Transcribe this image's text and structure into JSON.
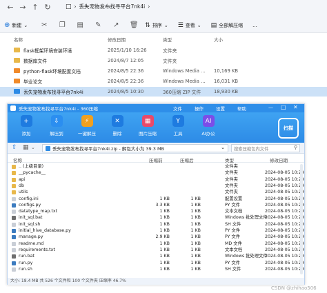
{
  "explorer": {
    "path": [
      "丢失宠物发布找寻平台7nk4i"
    ],
    "toolbar": {
      "new": "新建",
      "sort": "排序",
      "view": "查看",
      "extract_all": "全部解压缩",
      "more": "..."
    },
    "headers": {
      "name": "名称",
      "modified": "修改日期",
      "type": "类型",
      "size": "大小"
    },
    "rows": [
      {
        "name": "flask框架环境安装环境",
        "modified": "2025/1/10 16:26",
        "type": "文件夹",
        "size": "",
        "icon": "folder"
      },
      {
        "name": "数据库文件",
        "modified": "2024/8/7 12:05",
        "type": "文件夹",
        "size": "",
        "icon": "folder"
      },
      {
        "name": "python-flask环境配置文档",
        "modified": "2024/8/5 22:36",
        "type": "Windows Media ...",
        "size": "10,169 KB",
        "icon": "media"
      },
      {
        "name": "毕业论文",
        "modified": "2024/8/5 22:36",
        "type": "Windows Media ...",
        "size": "16,031 KB",
        "icon": "media"
      },
      {
        "name": "丢失宠物发布找寻平台7nk4i",
        "modified": "2024/8/5 10:30",
        "type": "360压缩 ZIP 文件",
        "size": "18,930 KB",
        "icon": "zip",
        "selected": true
      }
    ]
  },
  "zip": {
    "title": "丢失宠物发布找寻平台7nk4i - 360压缩",
    "menu": [
      "文件",
      "操作",
      "设置",
      "帮助"
    ],
    "ribbon": [
      {
        "label": "添加",
        "icon": "add-icon",
        "color": "#1e7be0"
      },
      {
        "label": "解压到",
        "icon": "extract-icon",
        "color": "#2b8ef0"
      },
      {
        "label": "一键解压",
        "icon": "one-click-icon",
        "color": "#f0a020"
      },
      {
        "label": "删除",
        "icon": "delete-icon",
        "color": "#1e7be0"
      },
      {
        "label": "图片压缩",
        "icon": "image-compress-icon",
        "color": "#e84a6a"
      },
      {
        "label": "工具",
        "icon": "tools-icon",
        "color": "#1e7be0"
      },
      {
        "label": "AI办公",
        "icon": "ai-icon",
        "color": "#7b4de8"
      }
    ],
    "scan_label": "扫描",
    "path": "丢失宠物发布找寻平台7nk4i.zip - 解包大小为 39.3 MB",
    "search_placeholder": "搜索压缩包内文件",
    "headers": {
      "name": "名称",
      "compressed": "压缩前",
      "size": "压缩后",
      "type": "类型",
      "modified": "修改日期"
    },
    "rows": [
      {
        "name": ".. (上级目录)",
        "compressed": "",
        "size": "",
        "type": "文件夹",
        "modified": "",
        "icon": "folder"
      },
      {
        "name": "__pycache__",
        "compressed": "",
        "size": "",
        "type": "文件夹",
        "modified": "2024-08-05 10:29",
        "icon": "folder"
      },
      {
        "name": "api",
        "compressed": "",
        "size": "",
        "type": "文件夹",
        "modified": "2024-08-05 10:29",
        "icon": "folder"
      },
      {
        "name": "db",
        "compressed": "",
        "size": "",
        "type": "文件夹",
        "modified": "2024-08-05 10:29",
        "icon": "folder"
      },
      {
        "name": "utils",
        "compressed": "",
        "size": "",
        "type": "文件夹",
        "modified": "2024-08-05 10:29",
        "icon": "folder"
      },
      {
        "name": "config.ini",
        "compressed": "1 KB",
        "size": "1 KB",
        "type": "配置设置",
        "modified": "2024-08-05 10:29",
        "icon": "file"
      },
      {
        "name": "configs.py",
        "compressed": "3.3 KB",
        "size": "1 KB",
        "type": "PY 文件",
        "modified": "2024-08-05 10:29",
        "icon": "py"
      },
      {
        "name": "datatype_map.txt",
        "compressed": "1 KB",
        "size": "1 KB",
        "type": "文本文档",
        "modified": "2024-08-05 10:29",
        "icon": "file"
      },
      {
        "name": "init_sql.bat",
        "compressed": "1 KB",
        "size": "1 KB",
        "type": "Windows 批处理文件",
        "modified": "2024-08-05 10:29",
        "icon": "bat"
      },
      {
        "name": "init_sql.sh",
        "compressed": "1 KB",
        "size": "1 KB",
        "type": "SH 文件",
        "modified": "2024-08-05 10:29",
        "icon": "file"
      },
      {
        "name": "initial_hive_database.py",
        "compressed": "1 KB",
        "size": "1 KB",
        "type": "PY 文件",
        "modified": "2024-08-05 10:29",
        "icon": "py"
      },
      {
        "name": "manage.py",
        "compressed": "2.9 KB",
        "size": "1 KB",
        "type": "PY 文件",
        "modified": "2024-08-05 10:29",
        "icon": "py"
      },
      {
        "name": "readme.md",
        "compressed": "1 KB",
        "size": "1 KB",
        "type": "MD 文件",
        "modified": "2024-08-05 10:29",
        "icon": "file"
      },
      {
        "name": "requirements.txt",
        "compressed": "1 KB",
        "size": "1 KB",
        "type": "文本文档",
        "modified": "2024-08-05 10:29",
        "icon": "file"
      },
      {
        "name": "run.bat",
        "compressed": "1 KB",
        "size": "1 KB",
        "type": "Windows 批处理文件",
        "modified": "2024-08-05 10:29",
        "icon": "bat"
      },
      {
        "name": "run.py",
        "compressed": "1 KB",
        "size": "1 KB",
        "type": "PY 文件",
        "modified": "2024-08-05 10:29",
        "icon": "py"
      },
      {
        "name": "run.sh",
        "compressed": "1 KB",
        "size": "1 KB",
        "type": "SH 文件",
        "modified": "2024-08-05 10:29",
        "icon": "file"
      }
    ],
    "status": "大小: 18.4 MB 共 526 个文件和 100 个文件夹 压缩率 46.7%"
  },
  "watermark": "CSDN @zhihao506"
}
